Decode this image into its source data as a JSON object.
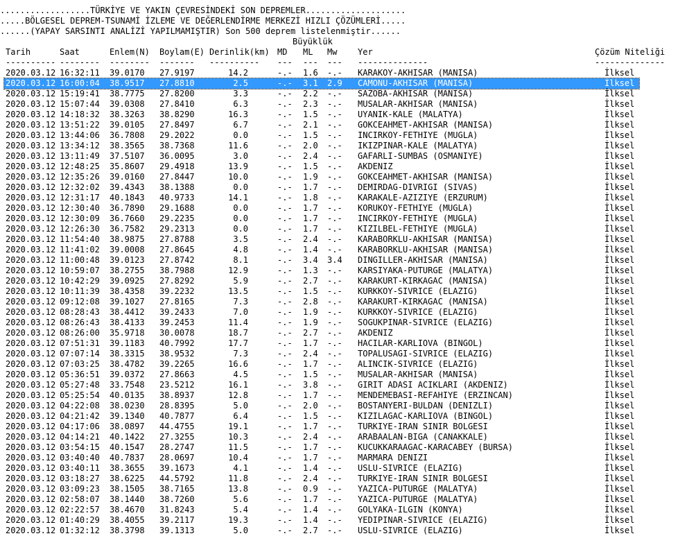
{
  "header": {
    "line1": "..................TÜRKİYE VE YAKIN ÇEVRESİNDEKİ SON DEPREMLER....................",
    "line2": ".....BÖLGESEL DEPREM-TSUNAMİ İZLEME VE DEĞERLENDİRME MERKEZİ HIZLI ÇÖZÜMLERİ.....",
    "line3": "......(YAPAY SARSINTI ANALİZİ YAPILMAMIŞTIR) Son 500 deprem listelenmiştir......"
  },
  "group_label": "Büyüklük",
  "columns": {
    "tarih": "Tarih",
    "saat": "Saat",
    "enlem": "Enlem(N)",
    "boylam": "Boylam(E)",
    "derinlik": "Derinlik(km)",
    "md": "MD",
    "ml": "ML",
    "mw": "Mw",
    "yer": "Yer",
    "cozum": "Çözüm Niteliği"
  },
  "dashes": {
    "tarih": "----------",
    "saat": "--------",
    "enlem": "--------",
    "boylam": "-------",
    "derinlik": "----------",
    "md": "---",
    "ml": "---",
    "mw": "---",
    "yer": "--------------",
    "cozum": "--------------"
  },
  "selected_row_index": 1,
  "rows": [
    {
      "date": "2020.03.12",
      "time": "16:32:11",
      "lat": "39.0170",
      "lon": "27.9197",
      "depth": "14.2",
      "md": "-.-",
      "ml": "1.6",
      "mw": "-.-",
      "place": "KARAKOY-AKHISAR (MANISA)",
      "quality": "İlksel"
    },
    {
      "date": "2020.03.12",
      "time": "16:00:04",
      "lat": "38.9517",
      "lon": "27.8810",
      "depth": "2.5",
      "md": "-.-",
      "ml": "3.1",
      "mw": "2.9",
      "place": "CAMONU-AKHISAR (MANISA)",
      "quality": "İlksel"
    },
    {
      "date": "2020.03.12",
      "time": "15:19:41",
      "lat": "38.7775",
      "lon": "27.8200",
      "depth": "3.3",
      "md": "-.-",
      "ml": "2.2",
      "mw": "-.-",
      "place": "SAZOBA-AKHISAR (MANISA)",
      "quality": "İlksel"
    },
    {
      "date": "2020.03.12",
      "time": "15:07:44",
      "lat": "39.0308",
      "lon": "27.8410",
      "depth": "6.3",
      "md": "-.-",
      "ml": "2.3",
      "mw": "-.-",
      "place": "MUSALAR-AKHISAR (MANISA)",
      "quality": "İlksel"
    },
    {
      "date": "2020.03.12",
      "time": "14:18:32",
      "lat": "38.3263",
      "lon": "38.8290",
      "depth": "16.3",
      "md": "-.-",
      "ml": "1.5",
      "mw": "-.-",
      "place": "UYANIK-KALE (MALATYA)",
      "quality": "İlksel"
    },
    {
      "date": "2020.03.12",
      "time": "13:51:22",
      "lat": "39.0105",
      "lon": "27.8497",
      "depth": "6.7",
      "md": "-.-",
      "ml": "2.1",
      "mw": "-.-",
      "place": "GOKCEAHMET-AKHISAR (MANISA)",
      "quality": "İlksel"
    },
    {
      "date": "2020.03.12",
      "time": "13:44:06",
      "lat": "36.7808",
      "lon": "29.2022",
      "depth": "0.0",
      "md": "-.-",
      "ml": "1.5",
      "mw": "-.-",
      "place": "INCIRKOY-FETHIYE (MUGLA)",
      "quality": "İlksel"
    },
    {
      "date": "2020.03.12",
      "time": "13:34:12",
      "lat": "38.3565",
      "lon": "38.7368",
      "depth": "11.6",
      "md": "-.-",
      "ml": "2.0",
      "mw": "-.-",
      "place": "IKIZPINAR-KALE (MALATYA)",
      "quality": "İlksel"
    },
    {
      "date": "2020.03.12",
      "time": "13:11:49",
      "lat": "37.5107",
      "lon": "36.0095",
      "depth": "3.0",
      "md": "-.-",
      "ml": "2.4",
      "mw": "-.-",
      "place": "GAFARLI-SUMBAS (OSMANIYE)",
      "quality": "İlksel"
    },
    {
      "date": "2020.03.12",
      "time": "12:48:25",
      "lat": "35.8607",
      "lon": "29.4918",
      "depth": "13.9",
      "md": "-.-",
      "ml": "1.5",
      "mw": "-.-",
      "place": "AKDENIZ",
      "quality": "İlksel"
    },
    {
      "date": "2020.03.12",
      "time": "12:35:26",
      "lat": "39.0160",
      "lon": "27.8447",
      "depth": "10.0",
      "md": "-.-",
      "ml": "1.9",
      "mw": "-.-",
      "place": "GOKCEAHMET-AKHISAR (MANISA)",
      "quality": "İlksel"
    },
    {
      "date": "2020.03.12",
      "time": "12:32:02",
      "lat": "39.4343",
      "lon": "38.1388",
      "depth": "0.0",
      "md": "-.-",
      "ml": "1.7",
      "mw": "-.-",
      "place": "DEMIRDAG-DIVRIGI (SIVAS)",
      "quality": "İlksel"
    },
    {
      "date": "2020.03.12",
      "time": "12:31:17",
      "lat": "40.1843",
      "lon": "40.9733",
      "depth": "14.1",
      "md": "-.-",
      "ml": "1.8",
      "mw": "-.-",
      "place": "KARAKALE-AZIZIYE (ERZURUM)",
      "quality": "İlksel"
    },
    {
      "date": "2020.03.12",
      "time": "12:30:40",
      "lat": "36.7890",
      "lon": "29.1688",
      "depth": "0.0",
      "md": "-.-",
      "ml": "1.7",
      "mw": "-.-",
      "place": "KORUKOY-FETHIYE (MUGLA)",
      "quality": "İlksel"
    },
    {
      "date": "2020.03.12",
      "time": "12:30:09",
      "lat": "36.7660",
      "lon": "29.2235",
      "depth": "0.0",
      "md": "-.-",
      "ml": "1.7",
      "mw": "-.-",
      "place": "INCIRKOY-FETHIYE (MUGLA)",
      "quality": "İlksel"
    },
    {
      "date": "2020.03.12",
      "time": "12:26:30",
      "lat": "36.7582",
      "lon": "29.2313",
      "depth": "0.0",
      "md": "-.-",
      "ml": "1.7",
      "mw": "-.-",
      "place": "KIZILBEL-FETHIYE (MUGLA)",
      "quality": "İlksel"
    },
    {
      "date": "2020.03.12",
      "time": "11:54:40",
      "lat": "38.9875",
      "lon": "27.8788",
      "depth": "3.5",
      "md": "-.-",
      "ml": "2.4",
      "mw": "-.-",
      "place": "KARABORKLU-AKHISAR (MANISA)",
      "quality": "İlksel"
    },
    {
      "date": "2020.03.12",
      "time": "11:41:02",
      "lat": "39.0008",
      "lon": "27.8645",
      "depth": "4.8",
      "md": "-.-",
      "ml": "1.4",
      "mw": "-.-",
      "place": "KARABORKLU-AKHISAR (MANISA)",
      "quality": "İlksel"
    },
    {
      "date": "2020.03.12",
      "time": "11:00:48",
      "lat": "39.0123",
      "lon": "27.8742",
      "depth": "8.1",
      "md": "-.-",
      "ml": "3.4",
      "mw": "3.4",
      "place": "DINGILLER-AKHISAR (MANISA)",
      "quality": "İlksel"
    },
    {
      "date": "2020.03.12",
      "time": "10:59:07",
      "lat": "38.2755",
      "lon": "38.7988",
      "depth": "12.9",
      "md": "-.-",
      "ml": "1.3",
      "mw": "-.-",
      "place": "KARSIYAKA-PUTURGE (MALATYA)",
      "quality": "İlksel"
    },
    {
      "date": "2020.03.12",
      "time": "10:42:29",
      "lat": "39.0925",
      "lon": "27.8292",
      "depth": "5.9",
      "md": "-.-",
      "ml": "2.7",
      "mw": "-.-",
      "place": "KARAKURT-KIRKAGAC (MANISA)",
      "quality": "İlksel"
    },
    {
      "date": "2020.03.12",
      "time": "10:11:39",
      "lat": "38.4358",
      "lon": "39.2232",
      "depth": "13.5",
      "md": "-.-",
      "ml": "1.5",
      "mw": "-.-",
      "place": "KURKKOY-SIVRICE (ELAZIG)",
      "quality": "İlksel"
    },
    {
      "date": "2020.03.12",
      "time": "09:12:08",
      "lat": "39.1027",
      "lon": "27.8165",
      "depth": "7.3",
      "md": "-.-",
      "ml": "2.8",
      "mw": "-.-",
      "place": "KARAKURT-KIRKAGAC (MANISA)",
      "quality": "İlksel"
    },
    {
      "date": "2020.03.12",
      "time": "08:28:43",
      "lat": "38.4412",
      "lon": "39.2433",
      "depth": "7.0",
      "md": "-.-",
      "ml": "1.9",
      "mw": "-.-",
      "place": "KURKKOY-SIVRICE (ELAZIG)",
      "quality": "İlksel"
    },
    {
      "date": "2020.03.12",
      "time": "08:26:43",
      "lat": "38.4133",
      "lon": "39.2453",
      "depth": "11.4",
      "md": "-.-",
      "ml": "1.9",
      "mw": "-.-",
      "place": "SOGUKPINAR-SIVRICE (ELAZIG)",
      "quality": "İlksel"
    },
    {
      "date": "2020.03.12",
      "time": "08:26:00",
      "lat": "35.9718",
      "lon": "30.0078",
      "depth": "18.7",
      "md": "-.-",
      "ml": "2.7",
      "mw": "-.-",
      "place": "AKDENIZ",
      "quality": "İlksel"
    },
    {
      "date": "2020.03.12",
      "time": "07:51:31",
      "lat": "39.1183",
      "lon": "40.7992",
      "depth": "17.7",
      "md": "-.-",
      "ml": "1.7",
      "mw": "-.-",
      "place": "HACILAR-KARLIOVA (BINGOL)",
      "quality": "İlksel"
    },
    {
      "date": "2020.03.12",
      "time": "07:07:14",
      "lat": "38.3315",
      "lon": "38.9532",
      "depth": "7.3",
      "md": "-.-",
      "ml": "2.4",
      "mw": "-.-",
      "place": "TOPALUSAGI-SIVRICE (ELAZIG)",
      "quality": "İlksel"
    },
    {
      "date": "2020.03.12",
      "time": "07:03:25",
      "lat": "38.4782",
      "lon": "39.2265",
      "depth": "16.6",
      "md": "-.-",
      "ml": "1.7",
      "mw": "-.-",
      "place": "ALINCIK-SIVRICE (ELAZIG)",
      "quality": "İlksel"
    },
    {
      "date": "2020.03.12",
      "time": "05:36:51",
      "lat": "39.0372",
      "lon": "27.8663",
      "depth": "4.5",
      "md": "-.-",
      "ml": "1.5",
      "mw": "-.-",
      "place": "MUSALAR-AKHISAR (MANISA)",
      "quality": "İlksel"
    },
    {
      "date": "2020.03.12",
      "time": "05:27:48",
      "lat": "33.7548",
      "lon": "23.5212",
      "depth": "16.1",
      "md": "-.-",
      "ml": "3.8",
      "mw": "-.-",
      "place": "GIRIT ADASI ACIKLARI (AKDENIZ)",
      "quality": "İlksel"
    },
    {
      "date": "2020.03.12",
      "time": "05:25:54",
      "lat": "40.0135",
      "lon": "38.8937",
      "depth": "12.8",
      "md": "-.-",
      "ml": "1.7",
      "mw": "-.-",
      "place": "MENDEMEBASI-REFAHIYE (ERZINCAN)",
      "quality": "İlksel"
    },
    {
      "date": "2020.03.12",
      "time": "04:22:08",
      "lat": "38.0230",
      "lon": "28.8395",
      "depth": "5.0",
      "md": "-.-",
      "ml": "2.0",
      "mw": "-.-",
      "place": "BOSTANYERI-BULDAN (DENIZLI)",
      "quality": "İlksel"
    },
    {
      "date": "2020.03.12",
      "time": "04:21:42",
      "lat": "39.1340",
      "lon": "40.7877",
      "depth": "6.4",
      "md": "-.-",
      "ml": "1.5",
      "mw": "-.-",
      "place": "KIZILAGAC-KARLIOVA (BINGOL)",
      "quality": "İlksel"
    },
    {
      "date": "2020.03.12",
      "time": "04:17:06",
      "lat": "38.0897",
      "lon": "44.4755",
      "depth": "19.1",
      "md": "-.-",
      "ml": "1.7",
      "mw": "-.-",
      "place": "TURKIYE-IRAN SINIR BOLGESI",
      "quality": "İlksel"
    },
    {
      "date": "2020.03.12",
      "time": "04:14:21",
      "lat": "40.1422",
      "lon": "27.3255",
      "depth": "10.3",
      "md": "-.-",
      "ml": "2.4",
      "mw": "-.-",
      "place": "ARABAALAN-BIGA (CANAKKALE)",
      "quality": "İlksel"
    },
    {
      "date": "2020.03.12",
      "time": "03:54:15",
      "lat": "40.1547",
      "lon": "28.2747",
      "depth": "11.5",
      "md": "-.-",
      "ml": "1.7",
      "mw": "-.-",
      "place": "KUCUKKARAAGAC-KARACABEY (BURSA)",
      "quality": "İlksel"
    },
    {
      "date": "2020.03.12",
      "time": "03:40:40",
      "lat": "40.7837",
      "lon": "28.0697",
      "depth": "10.4",
      "md": "-.-",
      "ml": "1.7",
      "mw": "-.-",
      "place": "MARMARA DENIZI",
      "quality": "İlksel"
    },
    {
      "date": "2020.03.12",
      "time": "03:40:11",
      "lat": "38.3655",
      "lon": "39.1673",
      "depth": "4.1",
      "md": "-.-",
      "ml": "1.4",
      "mw": "-.-",
      "place": "USLU-SIVRICE (ELAZIG)",
      "quality": "İlksel"
    },
    {
      "date": "2020.03.12",
      "time": "03:18:27",
      "lat": "38.6225",
      "lon": "44.5792",
      "depth": "11.8",
      "md": "-.-",
      "ml": "2.4",
      "mw": "-.-",
      "place": "TURKIYE-IRAN SINIR BOLGESI",
      "quality": "İlksel"
    },
    {
      "date": "2020.03.12",
      "time": "03:09:23",
      "lat": "38.1505",
      "lon": "38.7165",
      "depth": "13.8",
      "md": "-.-",
      "ml": "0.9",
      "mw": "-.-",
      "place": "YAZICA-PUTURGE (MALATYA)",
      "quality": "İlksel"
    },
    {
      "date": "2020.03.12",
      "time": "02:58:07",
      "lat": "38.1440",
      "lon": "38.7260",
      "depth": "5.6",
      "md": "-.-",
      "ml": "1.7",
      "mw": "-.-",
      "place": "YAZICA-PUTURGE (MALATYA)",
      "quality": "İlksel"
    },
    {
      "date": "2020.03.12",
      "time": "02:22:57",
      "lat": "38.4670",
      "lon": "31.8243",
      "depth": "5.4",
      "md": "-.-",
      "ml": "1.4",
      "mw": "-.-",
      "place": "GOLYAKA-ILGIN (KONYA)",
      "quality": "İlksel"
    },
    {
      "date": "2020.03.12",
      "time": "01:40:29",
      "lat": "38.4055",
      "lon": "39.2117",
      "depth": "19.3",
      "md": "-.-",
      "ml": "1.4",
      "mw": "-.-",
      "place": "YEDIPINAR-SIVRICE (ELAZIG)",
      "quality": "İlksel"
    },
    {
      "date": "2020.03.12",
      "time": "01:32:12",
      "lat": "38.3798",
      "lon": "39.1313",
      "depth": "5.0",
      "md": "-.-",
      "ml": "2.7",
      "mw": "-.-",
      "place": "USLU-SIVRICE (ELAZIG)",
      "quality": "İlksel"
    }
  ]
}
